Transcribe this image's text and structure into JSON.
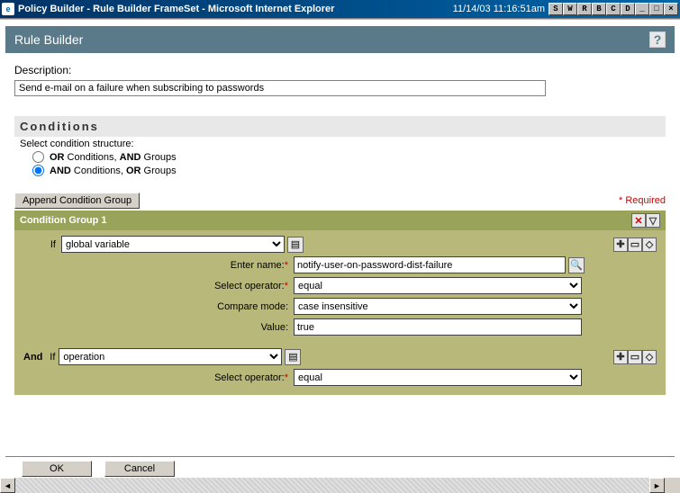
{
  "window": {
    "title": "Policy Builder - Rule Builder FrameSet - Microsoft Internet Explorer",
    "datetime": "11/14/03 11:16:51am",
    "btn_s": "S",
    "btn_w": "W",
    "btn_r": "R",
    "btn_b": "B",
    "btn_c": "C",
    "btn_d": "D",
    "btn_min": "_",
    "btn_max": "□",
    "btn_close": "×"
  },
  "panel": {
    "title": "Rule Builder",
    "help": "?"
  },
  "desc": {
    "label": "Description:",
    "value": "Send e-mail on a failure when subscribing to passwords"
  },
  "conditions": {
    "heading": "Conditions",
    "sub": "Select condition structure:",
    "opt_or": "OR Conditions, AND Groups",
    "opt_and": "AND Conditions, OR Groups",
    "selected": "and"
  },
  "append_btn": "Append Condition Group",
  "required": "* Required",
  "group": {
    "title": "Condition Group 1",
    "del": "✕",
    "down": "▽",
    "row1": {
      "if": "If",
      "type": "global variable",
      "name_label": "Enter name:",
      "name_value": "notify-user-on-password-dist-failure",
      "op_label": "Select operator:",
      "op_value": "equal",
      "mode_label": "Compare mode:",
      "mode_value": "case insensitive",
      "val_label": "Value:",
      "val_value": "true",
      "icons": {
        "plus": "✚",
        "minus": "▭",
        "updown": "◇"
      }
    },
    "row2": {
      "and": "And",
      "if": "If",
      "type": "operation",
      "op_label": "Select operator:",
      "op_value": "equal"
    }
  },
  "buttons": {
    "ok": "OK",
    "cancel": "Cancel"
  },
  "scroll": {
    "left": "◄",
    "right": "►"
  }
}
